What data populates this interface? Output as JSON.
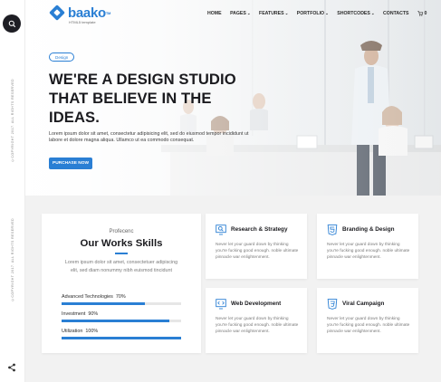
{
  "rail": {
    "copyright_top": "©COPYRIGHT 2017. ALL RIGHTS RESERVED",
    "copyright_bottom": "©COPYRIGHT 2017. ALL RIGHTS RESERVED",
    "search_icon": "search-icon",
    "share_icon": "share-icon"
  },
  "brand": {
    "name": "baako",
    "tm": "TM",
    "tagline": "HTML5 template",
    "color": "#2a7fd4"
  },
  "nav": {
    "items": [
      {
        "label": "HOME",
        "dropdown": false
      },
      {
        "label": "PAGES",
        "dropdown": true
      },
      {
        "label": "FEATURES",
        "dropdown": true
      },
      {
        "label": "PORTFOLIO",
        "dropdown": true
      },
      {
        "label": "SHORTCODES",
        "dropdown": true
      },
      {
        "label": "CONTACTS",
        "dropdown": false
      }
    ],
    "cart_count": "0"
  },
  "hero": {
    "badge": "Design",
    "title": "WE'RE A DESIGN STUDIO THAT BELIEVE IN THE IDEAS.",
    "text": "Lorem ipsum dolor sit amet, consectetur adipisicing elit, sed do eiusmod tempor incididunt ut labore et dolore magna aliqua. Ullamco ut ea commodo consequat.",
    "button": "PURCHASE NOW"
  },
  "skills": {
    "kicker": "Profecenc",
    "title": "Our Works Skills",
    "description": "Lorem ipsum dolor sit amet, consectetuer adipiscing elit, sed diam nonummy nibh euismod tincidunt",
    "bars": [
      {
        "label": "Advanced Technologies",
        "percent_label": "70%",
        "value": 0.7
      },
      {
        "label": "Investment",
        "percent_label": "90%",
        "value": 0.9
      },
      {
        "label": "Utilization",
        "percent_label": "100%",
        "value": 1.0
      }
    ]
  },
  "services": [
    {
      "title": "Research & Strategy",
      "icon": "search-screen-icon",
      "text": "Never let your guard down by thinking you're fucking good enough. noble ultimate pinnacle war enlightenment."
    },
    {
      "title": "Branding & Design",
      "icon": "html5-icon",
      "text": "Never let your guard down by thinking you're fucking good enough. noble ultimate pinnacle war enlightenment."
    },
    {
      "title": "Web Development",
      "icon": "monitor-code-icon",
      "text": "Never let your guard down by thinking you're fucking good enough. noble ultimate pinnacle war enlightenment."
    },
    {
      "title": "Viral Campaign",
      "icon": "css3-icon",
      "text": "Never let your guard down by thinking you're fucking good enough. noble ultimate pinnacle war enlightenment."
    }
  ]
}
